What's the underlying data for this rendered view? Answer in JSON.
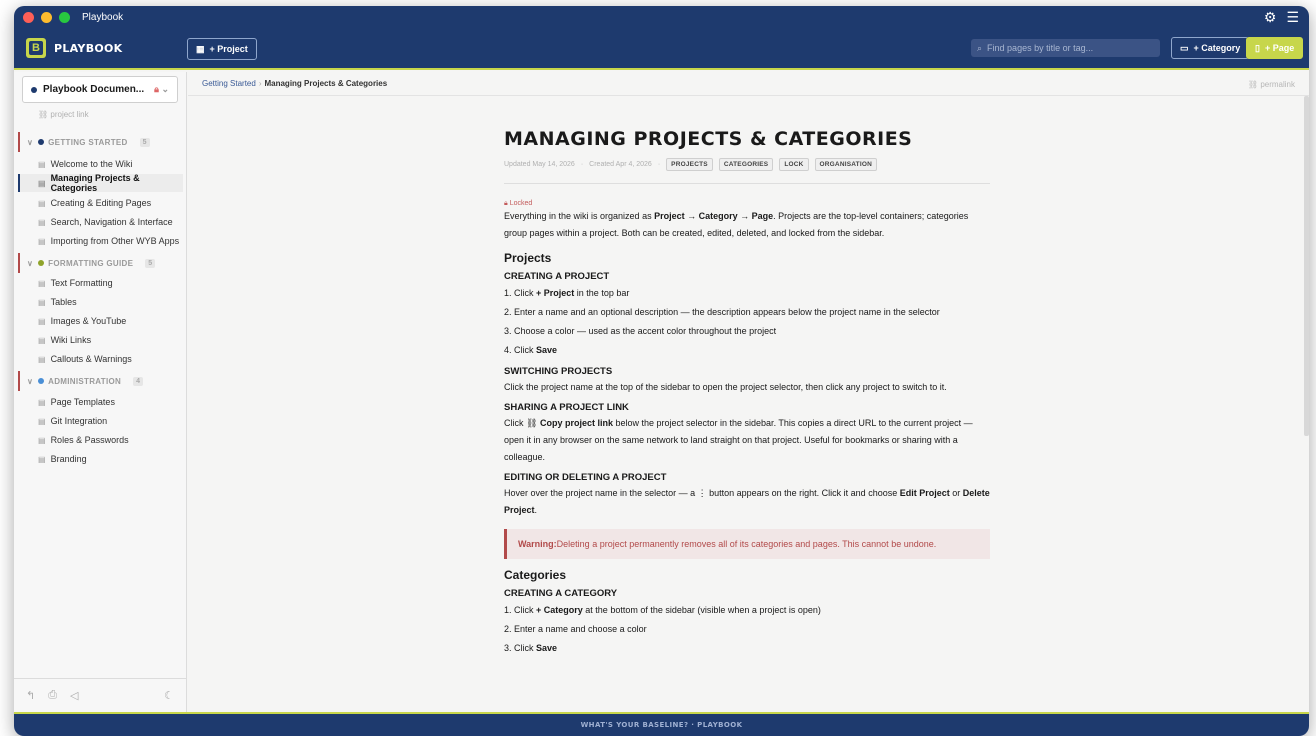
{
  "window": {
    "title": "Playbook"
  },
  "header": {
    "logo_letter": "B",
    "logo_text": "PLAYBOOK",
    "project_btn": "+ Project",
    "search_placeholder": "Find pages by title or tag...",
    "category_btn": "+ Category",
    "page_btn": "+ Page"
  },
  "sidebar": {
    "project_name": "Playbook Documen...",
    "project_link": "project link",
    "categories": [
      {
        "name": "GETTING STARTED",
        "count": "5",
        "color": "#1e3a6e",
        "items": [
          "Welcome to the Wiki",
          "Managing Projects & Categories",
          "Creating & Editing Pages",
          "Search, Navigation & Interface",
          "Importing from Other WYB Apps"
        ]
      },
      {
        "name": "FORMATTING GUIDE",
        "count": "5",
        "color": "#8fa32a",
        "items": [
          "Text Formatting",
          "Tables",
          "Images & YouTube",
          "Wiki Links",
          "Callouts & Warnings"
        ]
      },
      {
        "name": "ADMINISTRATION",
        "count": "4",
        "color": "#4a8fd6",
        "items": [
          "Page Templates",
          "Git Integration",
          "Roles & Passwords",
          "Branding"
        ]
      }
    ],
    "active_item": "Managing Projects & Categories"
  },
  "breadcrumb": {
    "parent": "Getting Started",
    "current": "Managing Projects & Categories",
    "permalink": "permalink"
  },
  "article": {
    "title": "MANAGING PROJECTS & CATEGORIES",
    "updated": "Updated May 14, 2026",
    "created": "Created Apr 4, 2026",
    "tags": [
      "PROJECTS",
      "CATEGORIES",
      "LOCK",
      "ORGANISATION"
    ],
    "locked_label": "Locked",
    "intro_a": "Everything in the wiki is organized as ",
    "intro_b": "Project → Category → Page",
    "intro_c": ". Projects are the top-level containers; categories group pages within a project. Both can be created, edited, deleted, and locked from the sidebar.",
    "h_projects": "Projects",
    "h_create_project": "CREATING A PROJECT",
    "cp1_a": "1. Click ",
    "cp1_b": "+ Project",
    "cp1_c": " in the top bar",
    "cp2": "2. Enter a name and an optional description — the description appears below the project name in the selector",
    "cp3": "3. Choose a color — used as the accent color throughout the project",
    "cp4_a": "4. Click ",
    "cp4_b": "Save",
    "h_switch": "SWITCHING PROJECTS",
    "switch_text": "Click the project name at the top of the sidebar to open the project selector, then click any project to switch to it.",
    "h_share": "SHARING A PROJECT LINK",
    "share_a": "Click ",
    "share_b": "Copy project link",
    "share_c": " below the project selector in the sidebar. This copies a direct URL to the current project — open it in any browser on the same network to land straight on that project. Useful for bookmarks or sharing with a colleague.",
    "h_edit": "EDITING OR DELETING A PROJECT",
    "edit_a": "Hover over the project name in the selector — a ⋮ button appears on the right. Click it and choose ",
    "edit_b": "Edit Project",
    "edit_c": " or ",
    "edit_d": "Delete Project",
    "edit_e": ".",
    "warn_label": "Warning:",
    "warn_text": " Deleting a project permanently removes all of its categories and pages. This cannot be undone.",
    "h_categories": "Categories",
    "h_create_cat": "CREATING A CATEGORY",
    "cc1_a": "1. Click ",
    "cc1_b": "+ Category",
    "cc1_c": " at the bottom of the sidebar (visible when a project is open)",
    "cc2": "2. Enter a name and choose a color",
    "cc3_a": "3. Click ",
    "cc3_b": "Save"
  },
  "footer": {
    "text": "WHAT'S YOUR BASELINE? · PLAYBOOK"
  }
}
